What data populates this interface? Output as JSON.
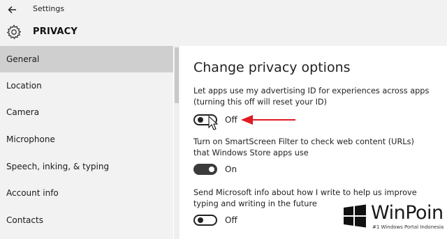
{
  "window": {
    "title": "Settings"
  },
  "header": {
    "section": "PRIVACY"
  },
  "sidebar": {
    "items": [
      {
        "label": "General",
        "active": true
      },
      {
        "label": "Location"
      },
      {
        "label": "Camera"
      },
      {
        "label": "Microphone"
      },
      {
        "label": "Speech, inking, & typing"
      },
      {
        "label": "Account info"
      },
      {
        "label": "Contacts"
      }
    ]
  },
  "main": {
    "heading": "Change privacy options",
    "options": [
      {
        "text": "Let apps use my advertising ID for experiences across apps (turning this off will reset your ID)",
        "state": "Off"
      },
      {
        "text": "Turn on SmartScreen Filter to check web content (URLs) that Windows Store apps use",
        "state": "On"
      },
      {
        "text": "Send Microsoft info about how I write to help us improve typing and writing in the future",
        "state": "Off"
      }
    ]
  },
  "annotation": {
    "arrow_color": "#e01b24"
  },
  "watermark": {
    "name": "WinPoin",
    "tagline": "#1 Windows Portal Indonesia"
  },
  "icons": [
    "back-arrow-icon",
    "gear-icon",
    "mouse-cursor-icon",
    "windows-logo-icon"
  ]
}
